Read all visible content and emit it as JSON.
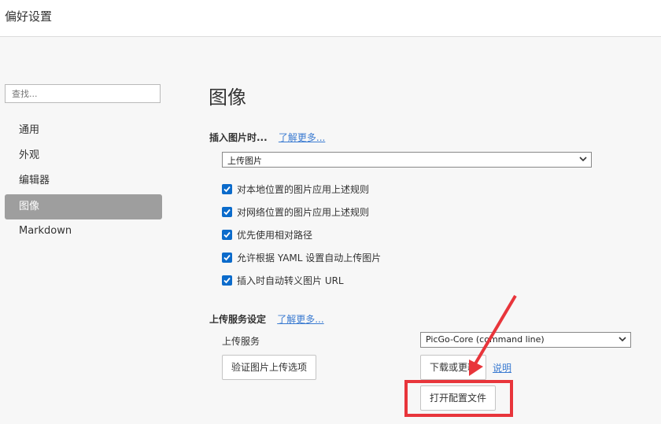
{
  "window": {
    "title": "偏好设置"
  },
  "sidebar": {
    "search_placeholder": "查找...",
    "items": [
      {
        "label": "通用",
        "active": false
      },
      {
        "label": "外观",
        "active": false
      },
      {
        "label": "编辑器",
        "active": false
      },
      {
        "label": "图像",
        "active": true
      },
      {
        "label": "Markdown",
        "active": false
      }
    ]
  },
  "main": {
    "heading": "图像",
    "insert_section": {
      "label": "插入图片时...",
      "learn_more": "了解更多...",
      "select_value": "上传图片",
      "checkboxes": [
        {
          "label": "对本地位置的图片应用上述规则",
          "checked": true
        },
        {
          "label": "对网络位置的图片应用上述规则",
          "checked": true
        },
        {
          "label": "优先使用相对路径",
          "checked": true
        },
        {
          "label": "允许根据 YAML 设置自动上传图片",
          "checked": true
        },
        {
          "label": "插入时自动转义图片 URL",
          "checked": true
        }
      ]
    },
    "upload_section": {
      "label": "上传服务设定",
      "learn_more": "了解更多...",
      "service_label": "上传服务",
      "service_value": "PicGo-Core (command line)",
      "verify_button": "验证图片上传选项",
      "download_button": "下载或更新",
      "help_link": "说明",
      "open_config_button": "打开配置文件"
    }
  },
  "annotation": {
    "color": "#e8353b"
  }
}
